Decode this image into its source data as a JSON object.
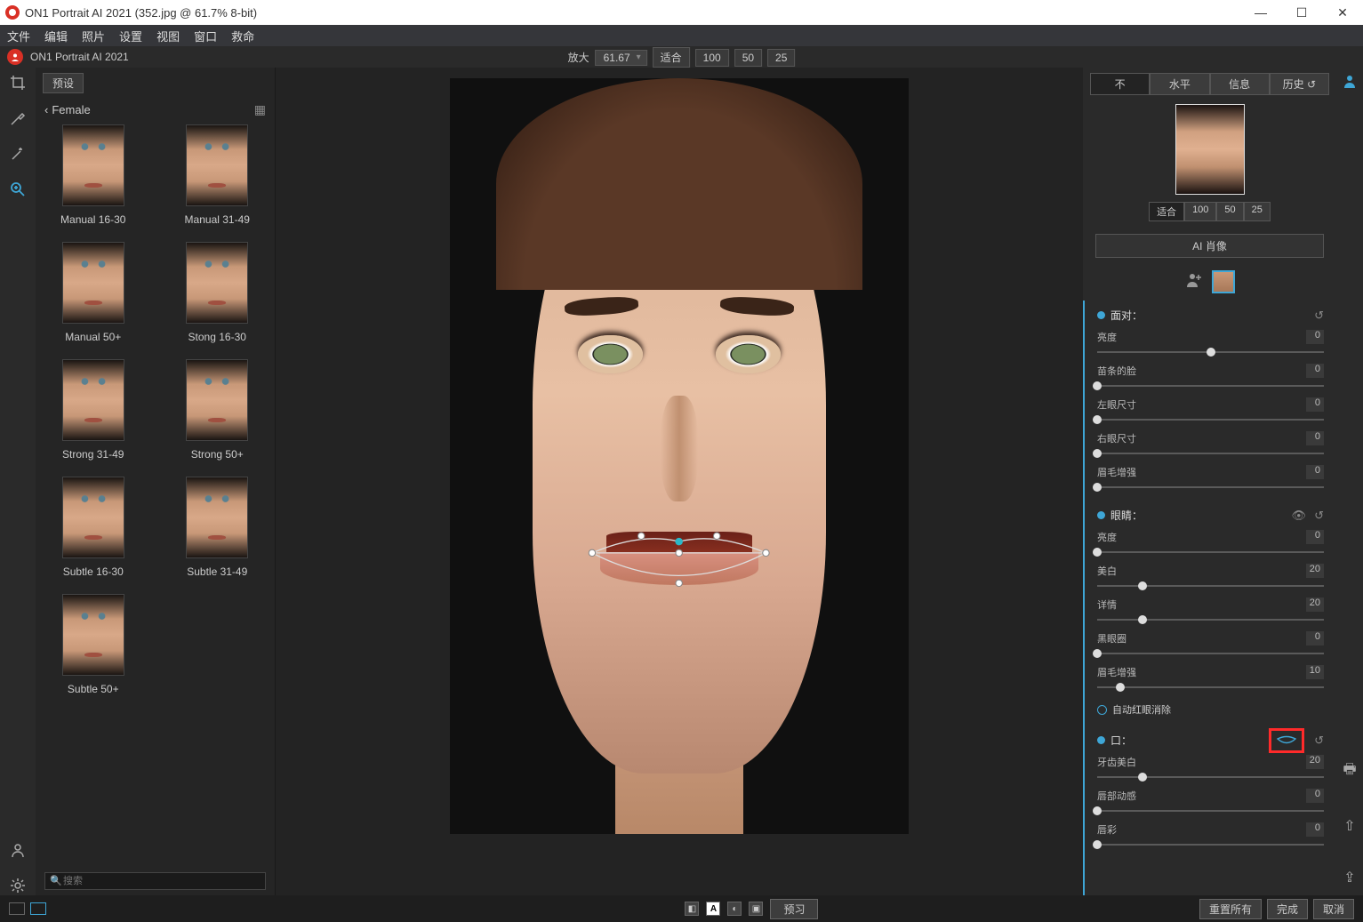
{
  "titlebar": {
    "title": "ON1 Portrait AI 2021 (352.jpg @ 61.7% 8-bit)"
  },
  "menubar": [
    "文件",
    "编辑",
    "照片",
    "设置",
    "视图",
    "窗口",
    "救命"
  ],
  "breadcrumb": "ON1 Portrait AI 2021",
  "topcenter": {
    "zoom_label": "放大",
    "zoom_value": "61.67",
    "fit": "适合",
    "b100": "100",
    "b50": "50",
    "b25": "25"
  },
  "presets": {
    "tab": "预设",
    "back": "Female",
    "items": [
      {
        "label": "Manual 16-30"
      },
      {
        "label": "Manual 31-49"
      },
      {
        "label": "Manual 50+"
      },
      {
        "label": "Stong 16-30"
      },
      {
        "label": "Strong 31-49"
      },
      {
        "label": "Strong 50+"
      },
      {
        "label": "Subtle 16-30"
      },
      {
        "label": "Subtle 31-49"
      },
      {
        "label": "Subtle 50+"
      }
    ],
    "search_ph": "搜索"
  },
  "rtabs": [
    "不",
    "水平",
    "信息",
    "历史 ↺"
  ],
  "navfit": {
    "fit": "适合",
    "b100": "100",
    "b50": "50",
    "b25": "25"
  },
  "ai_button": "AI 肖像",
  "groups": [
    {
      "title": "面对：",
      "reset": true,
      "sliders": [
        {
          "label": "亮度",
          "value": 0,
          "pos": 50
        },
        {
          "label": "苗条的脸",
          "value": 0,
          "pos": 0
        },
        {
          "label": "左眼尺寸",
          "value": 0,
          "pos": 0
        },
        {
          "label": "右眼尺寸",
          "value": 0,
          "pos": 0
        },
        {
          "label": "眉毛增强",
          "value": 0,
          "pos": 0
        }
      ]
    },
    {
      "title": "眼睛：",
      "vis": true,
      "reset": true,
      "sliders": [
        {
          "label": "亮度",
          "value": 0,
          "pos": 0
        },
        {
          "label": "美白",
          "value": 20,
          "pos": 20
        },
        {
          "label": "详情",
          "value": 20,
          "pos": 20
        },
        {
          "label": "黑眼圈",
          "value": 0,
          "pos": 0
        },
        {
          "label": "眉毛增强",
          "value": 10,
          "pos": 10
        }
      ],
      "checkbox": "自动红眼消除"
    },
    {
      "title": "口：",
      "mouth_icon": true,
      "reset": true,
      "sliders": [
        {
          "label": "牙齿美白",
          "value": 20,
          "pos": 20
        },
        {
          "label": "唇部动感",
          "value": 0,
          "pos": 0
        },
        {
          "label": "唇彩",
          "value": 0,
          "pos": 0
        }
      ]
    }
  ],
  "bottombar": {
    "preview": "预习",
    "reset_all": "重置所有",
    "done": "完成",
    "cancel": "取消"
  }
}
